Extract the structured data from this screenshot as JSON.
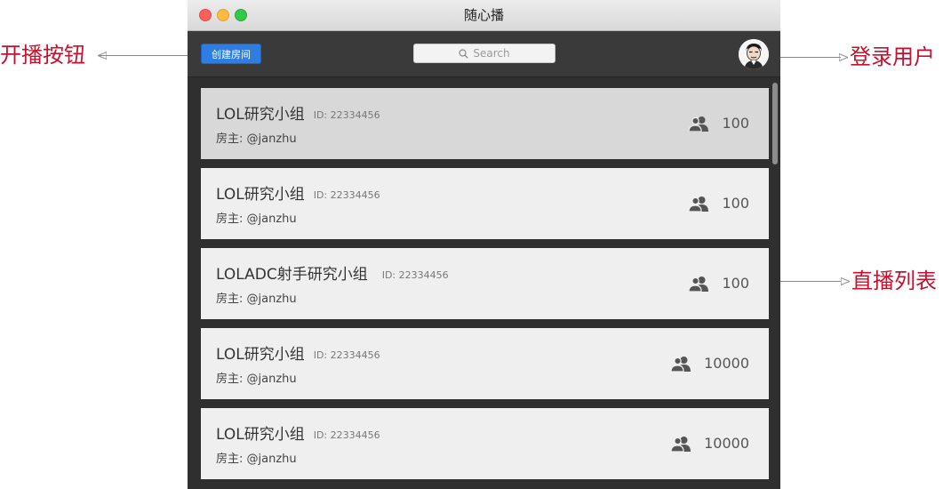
{
  "annotations": {
    "create_button": "开播按钮",
    "login_user": "登录用户",
    "live_list": "直播列表"
  },
  "window": {
    "title": "随心播"
  },
  "toolbar": {
    "create_room_label": "创建房间",
    "search_placeholder": "Search"
  },
  "rooms": [
    {
      "name": "LOL研究小组",
      "id": "ID: 22334456",
      "host": "房主: @janzhu",
      "viewers": "100"
    },
    {
      "name": "LOL研究小组",
      "id": "ID: 22334456",
      "host": "房主: @janzhu",
      "viewers": "100"
    },
    {
      "name": "LOLADC射手研究小组",
      "id": "ID: 22334456",
      "host": "房主: @janzhu",
      "viewers": "100"
    },
    {
      "name": "LOL研究小组",
      "id": "ID: 22334456",
      "host": "房主: @janzhu",
      "viewers": "10000"
    },
    {
      "name": "LOL研究小组",
      "id": "ID: 22334456",
      "host": "房主: @janzhu",
      "viewers": "10000"
    }
  ],
  "colors": {
    "accent": "#2f7de1",
    "annotation": "#c8102e"
  },
  "icons": {
    "viewers": "users-icon",
    "search": "search-icon",
    "avatar": "user-avatar"
  }
}
